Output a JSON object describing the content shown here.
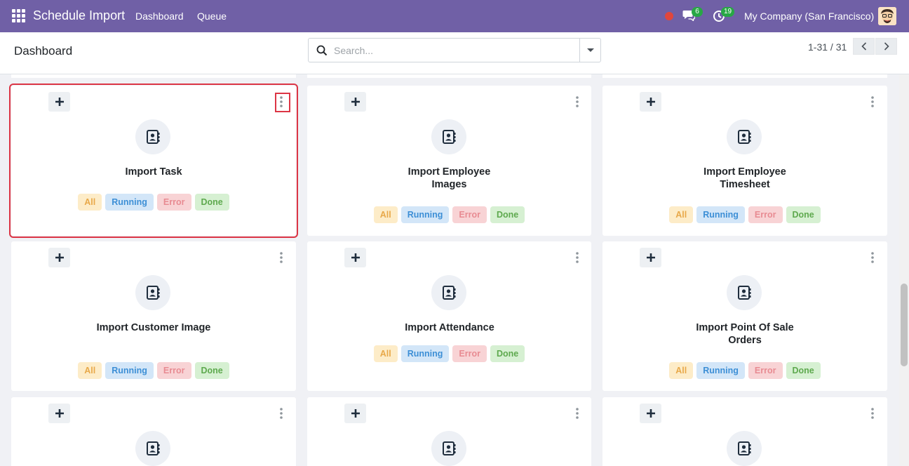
{
  "navbar": {
    "app_title": "Schedule Import",
    "menus": [
      "Dashboard",
      "Queue"
    ],
    "messages_count": "6",
    "activities_count": "19",
    "company": "My Company (San Francisco)"
  },
  "control_panel": {
    "breadcrumb": "Dashboard",
    "search_placeholder": "Search...",
    "pager_value": "1-31 / 31"
  },
  "cards": [
    {
      "title": "Import Task",
      "tags": [
        "All",
        "Running",
        "Error",
        "Done"
      ]
    },
    {
      "title": "Import Employee Images",
      "tags": [
        "All",
        "Running",
        "Error",
        "Done"
      ]
    },
    {
      "title": "Import Employee Timesheet",
      "tags": [
        "All",
        "Running",
        "Error",
        "Done"
      ]
    },
    {
      "title": "Import Customer Image",
      "tags": [
        "All",
        "Running",
        "Error",
        "Done"
      ]
    },
    {
      "title": "Import Attendance",
      "tags": [
        "All",
        "Running",
        "Error",
        "Done"
      ]
    },
    {
      "title": "Import Point Of Sale Orders",
      "tags": [
        "All",
        "Running",
        "Error",
        "Done"
      ]
    },
    {
      "title": "",
      "tags": []
    },
    {
      "title": "",
      "tags": []
    },
    {
      "title": "",
      "tags": []
    }
  ],
  "colors": {
    "navbar": "#7060a6",
    "highlight": "#dc3545",
    "tag_all": "#e8a94a",
    "tag_running": "#3d8fd6",
    "tag_error": "#e88b92",
    "tag_done": "#5ea94e"
  },
  "icons": {
    "apps": "apps-grid-icon",
    "chat": "chat-icon",
    "activity": "clock-icon",
    "card": "address-book-icon",
    "add": "plus-icon",
    "menu": "kebab-menu-icon"
  }
}
